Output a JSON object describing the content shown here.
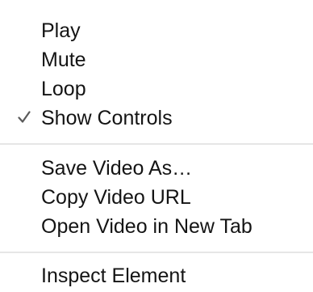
{
  "context_menu": {
    "groups": [
      {
        "items": [
          {
            "label": "Play",
            "checked": false
          },
          {
            "label": "Mute",
            "checked": false
          },
          {
            "label": "Loop",
            "checked": false
          },
          {
            "label": "Show Controls",
            "checked": true
          }
        ]
      },
      {
        "items": [
          {
            "label": "Save Video As…",
            "checked": false
          },
          {
            "label": "Copy Video URL",
            "checked": false
          },
          {
            "label": "Open Video in New Tab",
            "checked": false
          }
        ]
      },
      {
        "items": [
          {
            "label": "Inspect Element",
            "checked": false
          }
        ]
      }
    ],
    "check_icon": "checkmark-icon",
    "colors": {
      "background": "#ffffff",
      "text": "#141414",
      "checkmark": "#5a5a5a",
      "separator": "#e6e6e6"
    }
  }
}
